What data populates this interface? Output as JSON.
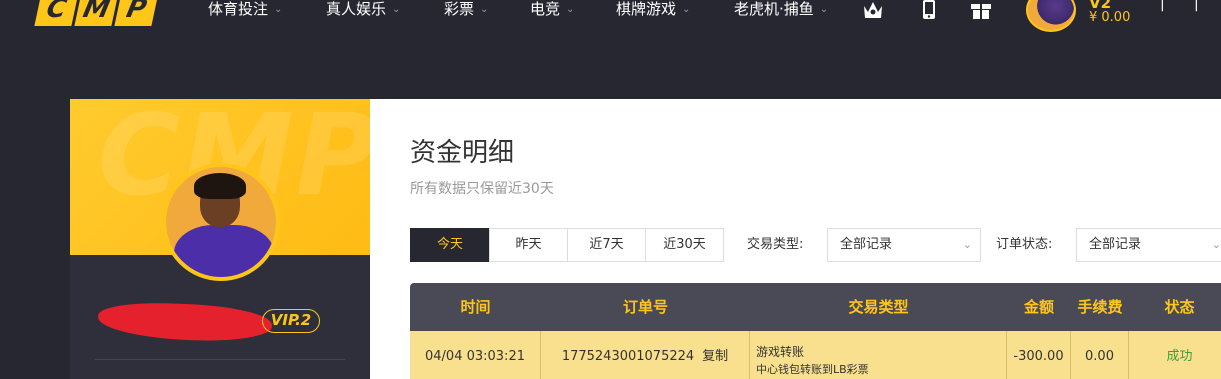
{
  "logo": {
    "letters": [
      "C",
      "M",
      "P"
    ]
  },
  "nav": {
    "items": [
      {
        "label": "体育投注"
      },
      {
        "label": "真人娱乐"
      },
      {
        "label": "彩票"
      },
      {
        "label": "电竞"
      },
      {
        "label": "棋牌游戏"
      },
      {
        "label": "老虎机·捕鱼"
      }
    ],
    "caret": "⌄"
  },
  "user": {
    "vip_top": "V2",
    "balance": "¥ 0.00",
    "vip_badge": "VIP.2"
  },
  "page": {
    "title": "资金明细",
    "subtitle": "所有数据只保留近30天"
  },
  "tabs": [
    {
      "label": "今天",
      "active": true
    },
    {
      "label": "昨天",
      "active": false
    },
    {
      "label": "近7天",
      "active": false
    },
    {
      "label": "近30天",
      "active": false
    }
  ],
  "filters": {
    "type_label": "交易类型:",
    "type_value": "全部记录",
    "status_label": "订单状态:",
    "status_value": "全部记录"
  },
  "table": {
    "headers": [
      "时间",
      "订单号",
      "交易类型",
      "金额",
      "手续费",
      "状态"
    ],
    "rows": [
      {
        "time": "04/04 03:03:21",
        "order_no": "1775243001075224",
        "copy_label": "复制",
        "type_main": "游戏转账",
        "type_sub": "中心钱包转账到LB彩票",
        "amount": "-300.00",
        "fee": "0.00",
        "status": "成功"
      }
    ]
  },
  "colors": {
    "accent": "#ffc61a",
    "background": "#272732",
    "row_highlight": "#f9e08f",
    "success": "#3aa03a"
  }
}
